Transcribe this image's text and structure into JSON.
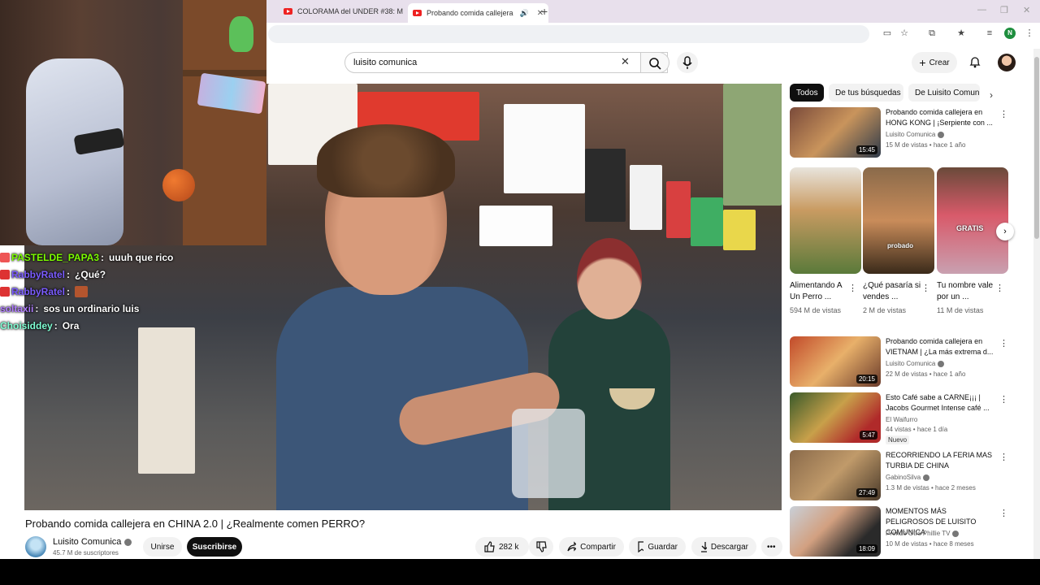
{
  "browser": {
    "tabs": [
      {
        "title": "COLORAMA del UNDER #38: M"
      },
      {
        "title": "Probando comida callejera"
      }
    ],
    "profile_letter": "N"
  },
  "header": {
    "search_value": "luisito comunica",
    "create_label": "Crear"
  },
  "video": {
    "title": "Probando comida callejera en CHINA 2.0 | ¿Realmente comen PERRO?",
    "channel": "Luisito Comunica",
    "subscribers": "45.7 M de suscriptores",
    "join_label": "Unirse",
    "subscribe_label": "Suscribirse",
    "likes": "282 k",
    "share_label": "Compartir",
    "save_label": "Guardar",
    "download_label": "Descargar"
  },
  "chat": [
    {
      "user": "PASTELDE_PAPA3",
      "message": "uuuh que rico",
      "color": "#7cfc00"
    },
    {
      "user": "RabbyRatel",
      "message": "¿Qué?",
      "color": "#7b5cff"
    },
    {
      "user": "RabbyRatel",
      "message": "",
      "color": "#7b5cff",
      "emote": "emote"
    },
    {
      "user": "soltaxii",
      "message": "sos un ordinario luis",
      "color": "#b07cff"
    },
    {
      "user": "Choisiddey",
      "message": "Ora",
      "color": "#7fffd4"
    }
  ],
  "sidebar": {
    "chips": [
      "Todos",
      "De tus búsquedas",
      "De Luisito Comunica"
    ],
    "recommendations": [
      {
        "title": "Probando comida callejera en HONG KONG | ¡Serpiente con ...",
        "channel": "Luisito Comunica",
        "verified": true,
        "meta": "15 M de vistas • hace 1 año",
        "duration": "15:45"
      },
      {
        "title": "Probando comida callejera en VIETNAM | ¿La más extrema d...",
        "channel": "Luisito Comunica",
        "verified": true,
        "meta": "22 M de vistas • hace 1 año",
        "duration": "20:15"
      },
      {
        "title": "Esto Café sabe a CARNE¡¡¡ | Jacobs Gourmet Intense café ...",
        "channel": "El Waifurro",
        "verified": false,
        "meta": "44 vistas • hace 1 día",
        "duration": "5:47",
        "badge": "Nuevo"
      },
      {
        "title": "RECORRIENDO LA FERIA MAS TURBIA DE CHINA",
        "channel": "GabinoSilva",
        "verified": true,
        "meta": "1.3 M de vistas • hace 2 meses",
        "duration": "27:49"
      },
      {
        "title": "MOMENTOS MÁS PELIGROSOS DE LUISITO COMUNICA",
        "channel": "Prende Otro Phillie TV",
        "verified": true,
        "meta": "10 M de vistas • hace 8 meses",
        "duration": "18:09"
      }
    ],
    "shorts": [
      {
        "title": "Alimentando A Un Perro ...",
        "views": "594 M de vistas"
      },
      {
        "title": "¿Qué pasaría si vendes ...",
        "views": "2 M de vistas",
        "overlay": "probado"
      },
      {
        "title": "Tu nombre vale por un ...",
        "views": "11 M de vistas",
        "overlay": "GRATIS"
      }
    ]
  },
  "colors": {
    "accent": "#ff0000",
    "chip_active": "#0f0f0f"
  }
}
